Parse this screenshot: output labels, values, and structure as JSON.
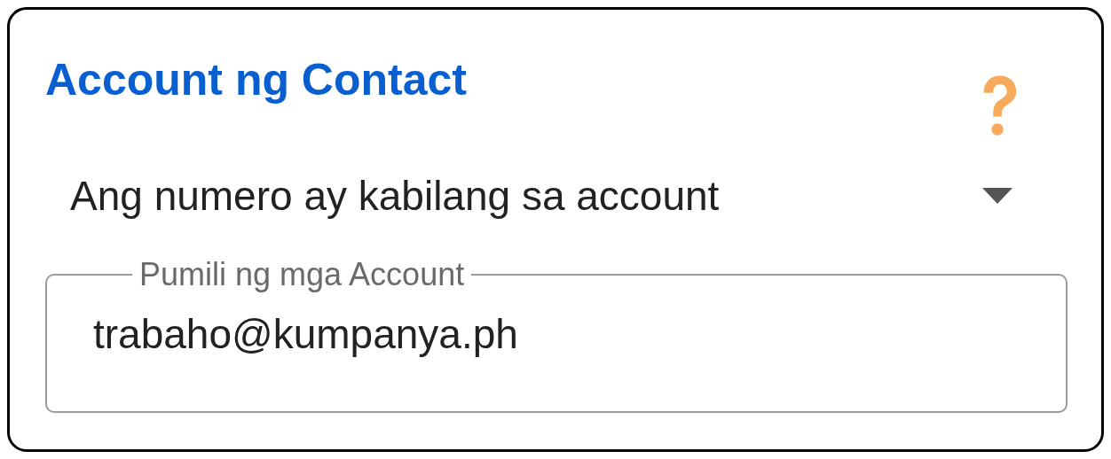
{
  "card": {
    "title": "Account ng Contact"
  },
  "dropdown": {
    "value": "Ang numero ay kabilang sa account"
  },
  "account_field": {
    "label": "Pumili ng mga Account",
    "value": "trabaho@kumpanya.ph"
  }
}
